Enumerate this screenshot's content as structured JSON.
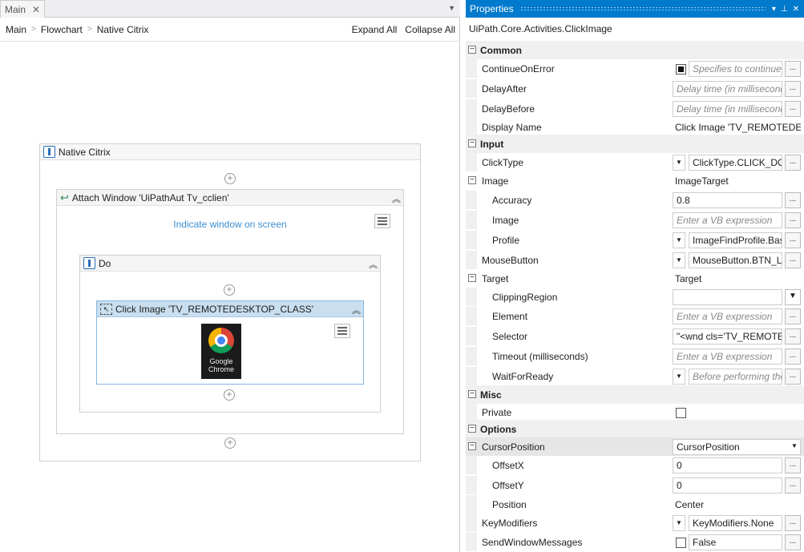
{
  "designer": {
    "tab_label": "Main",
    "tab_close": "✕",
    "breadcrumbs": [
      "Main",
      "Flowchart",
      "Native Citrix"
    ],
    "expand_all": "Expand All",
    "collapse_all": "Collapse All",
    "sequence_title": "Native Citrix",
    "attach_title": "Attach Window 'UiPathAut Tv_cclien'",
    "indicate_link": "Indicate window on screen",
    "do_title": "Do",
    "click_title": "Click Image 'TV_REMOTEDESKTOP_CLASS'",
    "thumbnail_caption": "Google Chrome",
    "accent_link": "#3b8ed0",
    "selected_bg": "#c9dff0"
  },
  "properties": {
    "title": "Properties",
    "type_name": "UiPath.Core.Activities.ClickImage",
    "title_bg": "#007acc",
    "categories": {
      "common": "Common",
      "input": "Input",
      "misc": "Misc",
      "options": "Options"
    },
    "rows": {
      "continue_on_error": {
        "name": "ContinueOnError",
        "value": "Specifies to continue executing",
        "ell": "..."
      },
      "delay_after": {
        "name": "DelayAfter",
        "value": "Delay time (in milliseconds)",
        "ell": "..."
      },
      "delay_before": {
        "name": "DelayBefore",
        "value": "Delay time (in milliseconds)",
        "ell": "..."
      },
      "display_name": {
        "name": "Display Name",
        "value": "Click Image 'TV_REMOTEDESKTOP_CLASS'"
      },
      "click_type": {
        "name": "ClickType",
        "value": "ClickType.CLICK_DOUBLE",
        "ell": "..."
      },
      "image": {
        "name": "Image",
        "value": "ImageTarget"
      },
      "accuracy": {
        "name": "Accuracy",
        "value": "0.8",
        "ell": "..."
      },
      "image_sub": {
        "name": "Image",
        "value": "Enter a VB expression",
        "ell": "..."
      },
      "profile": {
        "name": "Profile",
        "value": "ImageFindProfile.Basic",
        "ell": "..."
      },
      "mouse_button": {
        "name": "MouseButton",
        "value": "MouseButton.BTN_LEFT",
        "ell": "..."
      },
      "target": {
        "name": "Target",
        "value": "Target"
      },
      "clipping_region": {
        "name": "ClippingRegion",
        "value": ""
      },
      "element": {
        "name": "Element",
        "value": "Enter a VB expression",
        "ell": "..."
      },
      "selector": {
        "name": "Selector",
        "value": "\"<wnd cls='TV_REMOTEDESKTOP_CLASS' />\"",
        "ell": "..."
      },
      "timeout": {
        "name": "Timeout (milliseconds)",
        "value": "Enter a VB expression",
        "ell": "..."
      },
      "wait_for_ready": {
        "name": "WaitForReady",
        "value": "Before performing the action",
        "ell": "..."
      },
      "private": {
        "name": "Private"
      },
      "cursor_position": {
        "name": "CursorPosition",
        "value": "CursorPosition"
      },
      "offset_x": {
        "name": "OffsetX",
        "value": "0",
        "ell": "..."
      },
      "offset_y": {
        "name": "OffsetY",
        "value": "0",
        "ell": "..."
      },
      "position": {
        "name": "Position",
        "value": "Center"
      },
      "key_modifiers": {
        "name": "KeyModifiers",
        "value": "KeyModifiers.None",
        "ell": "..."
      },
      "send_window_messages": {
        "name": "SendWindowMessages",
        "value": "False",
        "ell": "..."
      }
    }
  }
}
